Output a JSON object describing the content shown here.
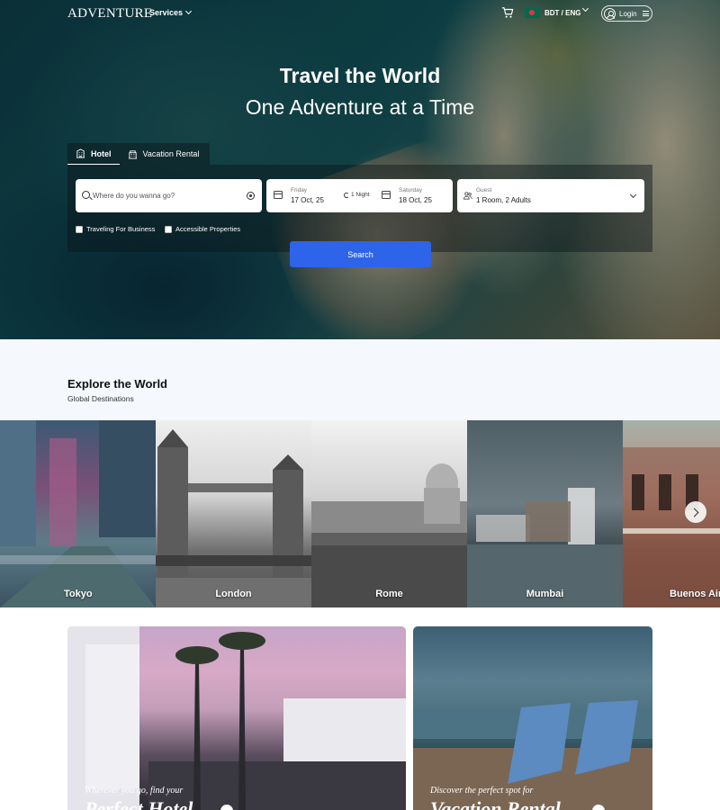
{
  "nav": {
    "logo": "ADVENTURE",
    "services_label": "Services",
    "currency_label": "BDT / ENG",
    "login_label": "Login"
  },
  "hero": {
    "title": "Travel the World",
    "subtitle": "One Adventure at a Time"
  },
  "search": {
    "tabs": [
      {
        "label": "Hotel",
        "icon": "hotel-icon",
        "active": true
      },
      {
        "label": "Vacation Rental",
        "icon": "building-icon",
        "active": false
      }
    ],
    "where_placeholder": "Where do you wanna go?",
    "checkin_day": "Friday",
    "checkin_date": "17 Oct, 25",
    "nights": "1 Night",
    "checkout_day": "Saturday",
    "checkout_date": "18 Oct, 25",
    "guest_label": "Guest",
    "guest_value": "1 Room, 2 Adults",
    "business_label": "Traveling For Business",
    "accessible_label": "Accessible Properties",
    "search_button": "Search"
  },
  "explore": {
    "title": "Explore the World",
    "subtitle": "Global Destinations",
    "cities": [
      "Tokyo",
      "London",
      "Rome",
      "Mumbai",
      "Buenos Aires"
    ]
  },
  "promos": [
    {
      "kicker": "Wherever you go, find your",
      "headline": "Perfect Hotel"
    },
    {
      "kicker": "Discover the perfect spot for",
      "headline": "Vacation Rental"
    }
  ],
  "colors": {
    "accent": "#2e64e9",
    "explore_bg": "#f5f8fd"
  }
}
